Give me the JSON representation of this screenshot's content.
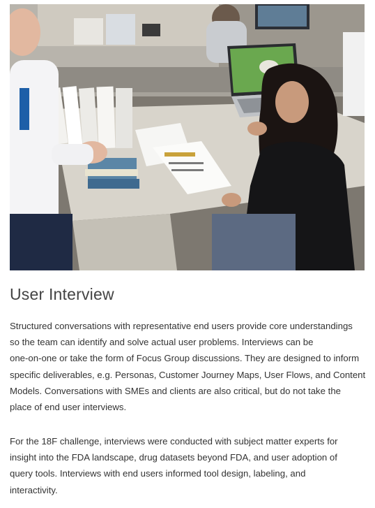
{
  "section": {
    "title": "User Interview",
    "photo_alt": "",
    "paragraphs": [
      {
        "lines": [
          "Structured conversations with representative end users provide core understandings",
          "so the team can identify and solve actual user problems. Interviews can be",
          "one-on-one or take the form of Focus Group discussions. They are designed to inform",
          "specific deliverables, e.g. Personas, Customer Journey Maps, User Flows, and Content",
          "Models. Conversations with SMEs and clients are also critical, but do not take the",
          "place of end user interviews."
        ]
      },
      {
        "lines": [
          "For the 18F challenge, interviews were conducted with subject matter experts for",
          "insight into the FDA landscape, drug datasets beyond FDA, and user adoption of",
          "query tools. Interviews with end users informed tool design, labeling, and",
          "interactivity."
        ]
      }
    ]
  }
}
